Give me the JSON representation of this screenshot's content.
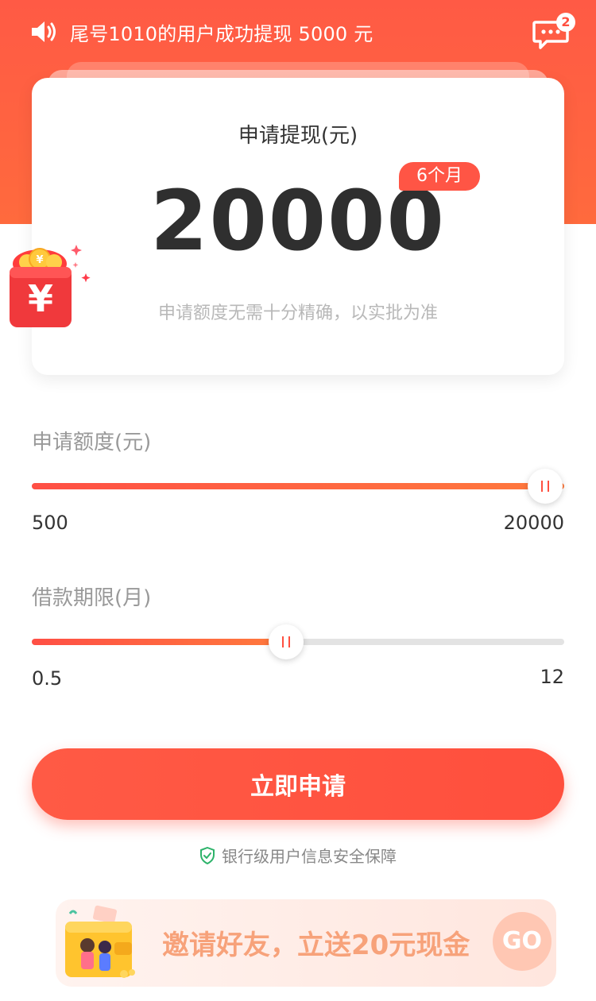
{
  "header": {
    "notice_text": "尾号1010的用户成功提现 5000 元",
    "speaker_icon": "speaker-icon",
    "message_icon": "chat-bubble-icon",
    "message_badge": "2"
  },
  "card": {
    "title": "申请提现(元)",
    "amount": "20000",
    "term_tag": "6个月",
    "hint": "申请额度无需十分精确，以实批为准"
  },
  "amount_slider": {
    "label": "申请额度(元)",
    "min_label": "500",
    "max_label": "20000",
    "min": 500,
    "max": 20000,
    "value": 20000
  },
  "term_slider": {
    "label": "借款期限(月)",
    "min_label": "0.5",
    "max_label": "12",
    "min": 0.5,
    "max": 12,
    "value": 6
  },
  "apply_button": "立即申请",
  "security_text": "银行级用户信息安全保障",
  "invite": {
    "text": "邀请好友，立送20元现金",
    "go_label": "GO"
  },
  "colors": {
    "primary": "#ff5545",
    "header": "#ff5a45",
    "secure_green": "#2db36a",
    "invite_text": "#f7a27a"
  }
}
